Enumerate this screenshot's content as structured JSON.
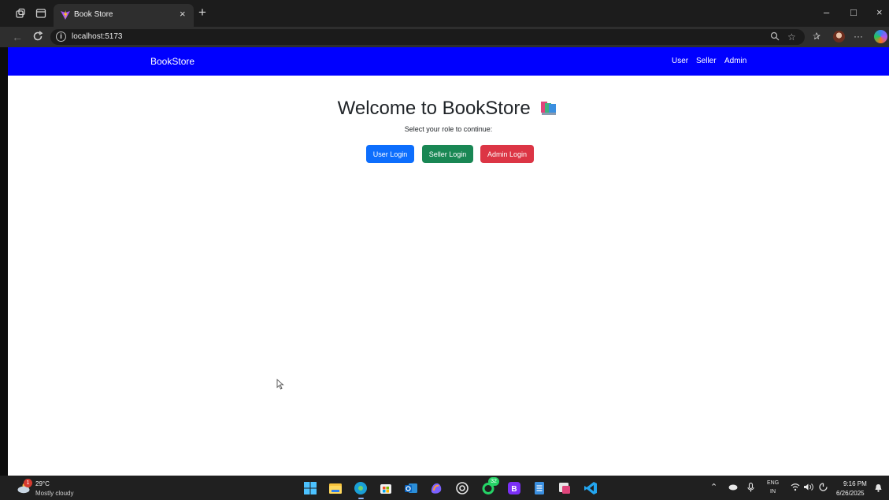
{
  "browser": {
    "tab_title": "Book Store",
    "tab_close": "×",
    "new_tab": "+",
    "url": "localhost:5173",
    "info_glyph": "i",
    "window_controls": {
      "minimize": "–",
      "maximize": "□",
      "close": "×"
    },
    "more_glyph": "···"
  },
  "navbar": {
    "brand": "BookStore",
    "links": [
      "User",
      "Seller",
      "Admin"
    ],
    "background": "#0000ff"
  },
  "main": {
    "heading": "Welcome to BookStore",
    "subtitle": "Select your role to continue:",
    "buttons": [
      {
        "label": "User Login",
        "color": "#0d6efd"
      },
      {
        "label": "Seller Login",
        "color": "#198754"
      },
      {
        "label": "Admin Login",
        "color": "#dc3545"
      }
    ]
  },
  "taskbar": {
    "weather_badge": "1",
    "temperature": "29°C",
    "condition": "Mostly cloudy",
    "whatsapp_badge": "32",
    "language": "ENG",
    "region": "IN",
    "time": "9:16 PM",
    "date": "6/26/2025"
  },
  "icons": {
    "tab_favicon": "vite-icon",
    "book_emoji": "books-icon",
    "taskbar_apps": [
      "windows-start-icon",
      "file-explorer-icon",
      "edge-icon",
      "store-icon",
      "outlook-icon",
      "copilot-icon",
      "chatgpt-icon",
      "whatsapp-icon",
      "bootstrap-icon",
      "notepad-icon",
      "snipping-tool-icon",
      "vscode-icon"
    ]
  }
}
